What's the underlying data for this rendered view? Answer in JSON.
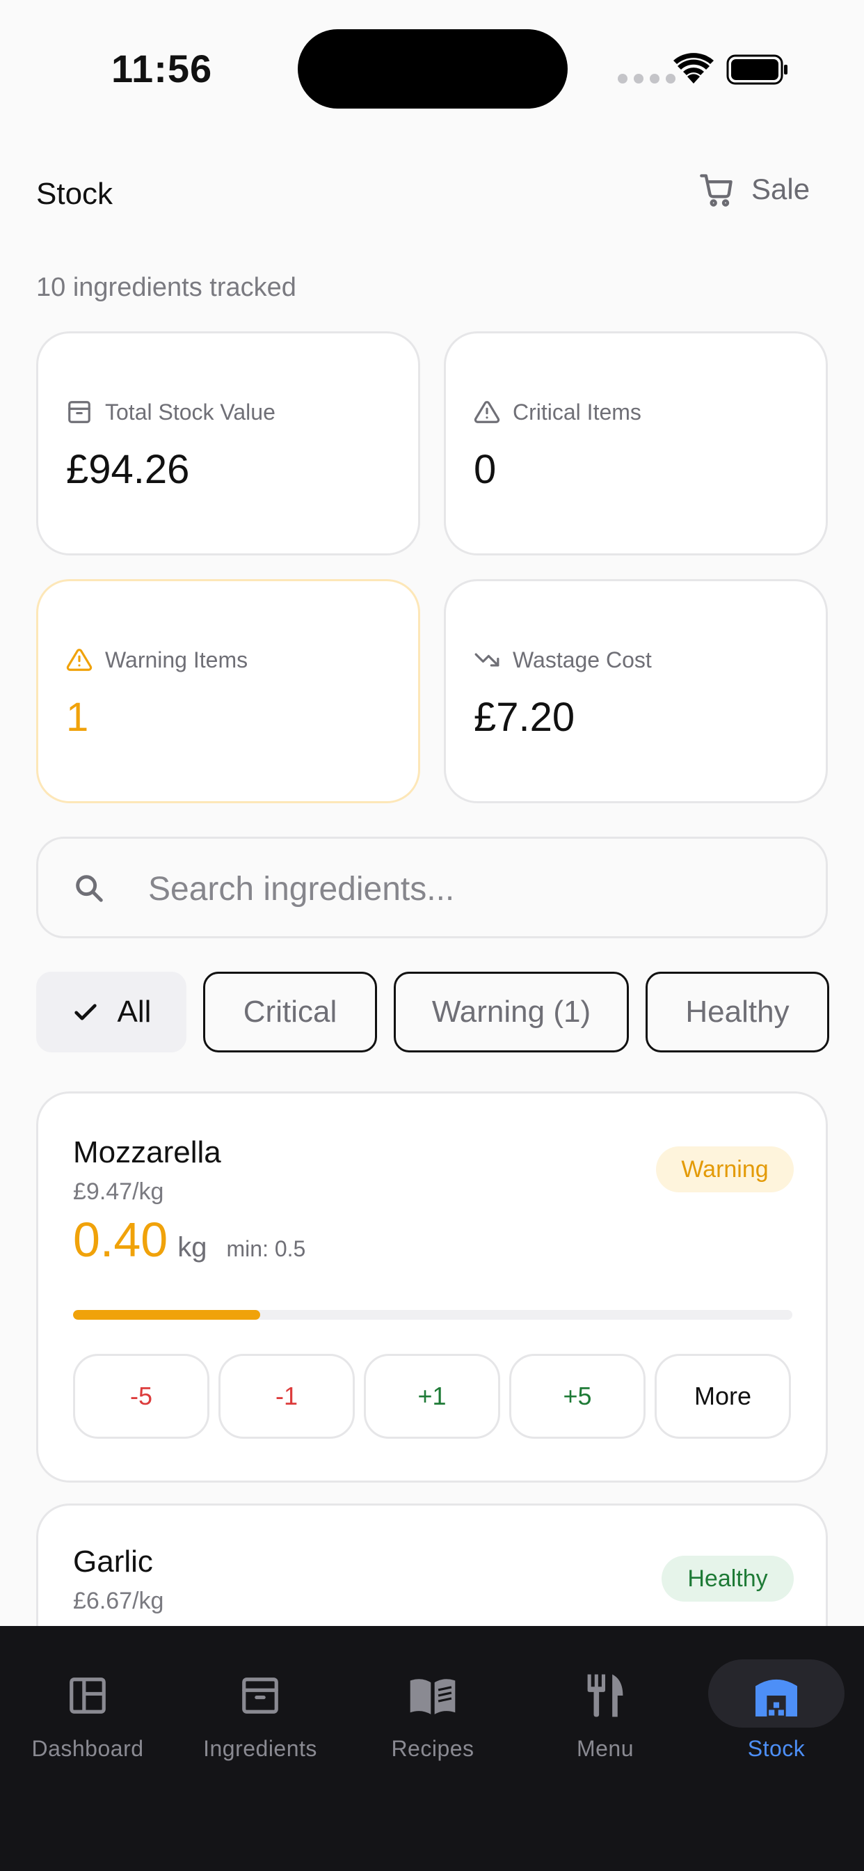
{
  "status_bar": {
    "time": "11:56"
  },
  "header": {
    "title": "Stock",
    "sale_label": "Sale",
    "subtitle": "10 ingredients tracked"
  },
  "stats": [
    {
      "label": "Total Stock Value",
      "value": "£94.26",
      "icon": "archive-icon"
    },
    {
      "label": "Critical Items",
      "value": "0",
      "icon": "alert-triangle-icon"
    },
    {
      "label": "Warning Items",
      "value": "1",
      "icon": "alert-triangle-icon"
    },
    {
      "label": "Wastage Cost",
      "value": "£7.20",
      "icon": "trending-down-icon"
    }
  ],
  "search": {
    "placeholder": "Search ingredients...",
    "value": ""
  },
  "filters": [
    {
      "label": "All",
      "active": true
    },
    {
      "label": "Critical",
      "active": false
    },
    {
      "label": "Warning (1)",
      "active": false
    },
    {
      "label": "Healthy",
      "active": false
    }
  ],
  "items": [
    {
      "name": "Mozzarella",
      "price": "£9.47/kg",
      "status": "Warning",
      "quantity": "0.40",
      "unit": "kg",
      "min": "min: 0.5",
      "stock_level_fraction": 0.26,
      "actions": [
        "-5",
        "-1",
        "+1",
        "+5",
        "More"
      ]
    },
    {
      "name": "Garlic",
      "price": "£6.67/kg",
      "status": "Healthy"
    }
  ],
  "nav": [
    {
      "label": "Dashboard",
      "icon": "dashboard-icon"
    },
    {
      "label": "Ingredients",
      "icon": "archive-icon"
    },
    {
      "label": "Recipes",
      "icon": "book-open-icon"
    },
    {
      "label": "Menu",
      "icon": "utensils-icon"
    },
    {
      "label": "Stock",
      "icon": "warehouse-icon",
      "active": true
    }
  ],
  "colors": {
    "accent": "#4d8ff7",
    "warning": "#f0a20a",
    "critical": "#dc3b3b",
    "healthy": "#1e7a36",
    "nav_bg": "#141417"
  }
}
